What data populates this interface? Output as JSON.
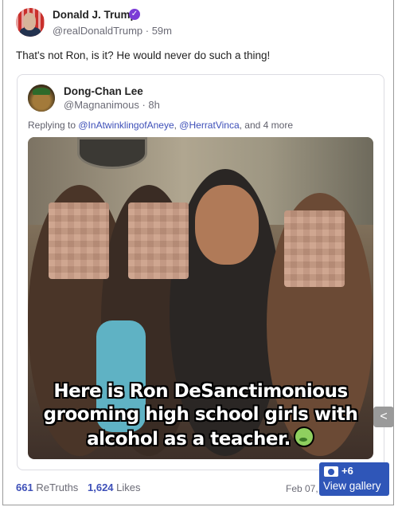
{
  "post": {
    "author_name": "Donald J. Trump",
    "author_handle": "@realDonaldTrump · 59m",
    "text": "That's not Ron, is it? He would never do such a thing!"
  },
  "quoted_post": {
    "author_name": "Dong-Chan Lee",
    "author_handle": "@Magnanimous · 8h",
    "replying_prefix": "Replying to ",
    "mention_1": "@InAtwinklingofAneye",
    "separator": ", ",
    "mention_2": "@HerratVinca",
    "replying_suffix": ", and 4 more",
    "image_caption_line1": "Here is Ron DeSanctimonious",
    "image_caption_line2": "grooming high school girls with",
    "image_caption_line3": "alcohol as a teacher."
  },
  "stats": {
    "retruths_count": "661",
    "retruths_label": "ReTruths",
    "likes_count": "1,624",
    "likes_label": "Likes",
    "date": "Feb 07,"
  },
  "gallery": {
    "count": "+6",
    "label": "View gallery"
  },
  "icons": {
    "verified": "verified-badge-icon",
    "share": "share-icon",
    "camera": "camera-icon",
    "emoji": "nauseated-face-emoji"
  },
  "colors": {
    "link": "#3d4fb8",
    "verified": "#7b3bd6",
    "gallery_bg": "#2f56b8"
  }
}
